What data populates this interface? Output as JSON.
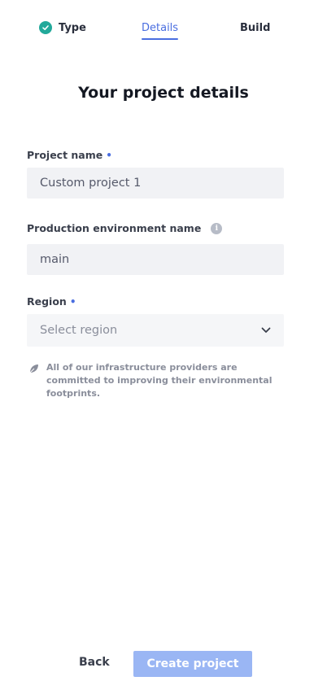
{
  "stepper": {
    "steps": [
      {
        "label": "Type",
        "state": "completed"
      },
      {
        "label": "Details",
        "state": "active"
      },
      {
        "label": "Build",
        "state": "pending"
      }
    ]
  },
  "title": "Your project details",
  "form": {
    "project_name": {
      "label": "Project name",
      "required_marker": "•",
      "value": "Custom project 1"
    },
    "env_name": {
      "label": "Production environment name",
      "info_icon": "i",
      "value": "main"
    },
    "region": {
      "label": "Region",
      "required_marker": "•",
      "placeholder": "Select region"
    }
  },
  "note": "All of our infrastructure providers are committed to improving their environmental footprints.",
  "footer": {
    "back_label": "Back",
    "create_label": "Create project"
  },
  "colors": {
    "accent": "#4a6ee0",
    "success": "#22a99a",
    "button_disabled": "#9ab6f4"
  }
}
